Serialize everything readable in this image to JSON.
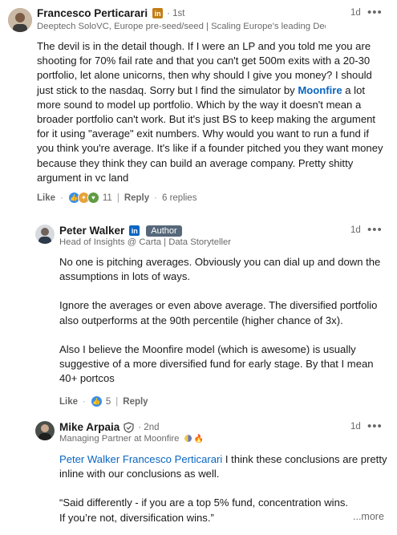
{
  "comments": [
    {
      "author": "Francesco Perticarari",
      "degree": "· 1st",
      "headline": "Deeptech SoloVC, Europe pre-seed/seed | Scaling Europe's leading Dee...",
      "time": "1d",
      "text_a": "The devil is in the detail though. If I were an LP and you told me you are shooting for 70% fail rate and that you can't get 500m exits with a 20-30 portfolio, let alone unicorns, then why should I give you money? I should just stick to the nasdaq. Sorry but I find the simulator by ",
      "text_link": "Moonfire",
      "text_b": " a lot more sound to model up portfolio. Which by the way it doesn't mean a broader portfolio can't work. But it's just BS to keep making the argument for it using \"average\" exit numbers. Why would you want to run a fund if you think you're average. It's like if a founder pitched you they want money because they think they can build an average company. Pretty shitty argument in vc land",
      "like_label": "Like",
      "reaction_count": "11",
      "reply_label": "Reply",
      "replies": "6 replies"
    },
    {
      "author": "Peter Walker",
      "badge": "Author",
      "headline": "Head of Insights @ Carta | Data Storyteller",
      "time": "1d",
      "p1": "No one is pitching averages. Obviously you can dial up and down the assumptions in lots of ways.",
      "p2": "Ignore the averages or even above average. The diversified portfolio also outperforms at the 90th percentile (higher chance of 3x).",
      "p3": "Also I believe the Moonfire model (which is awesome) is usually suggestive of a more diversified fund for early stage. By that I mean 40+ portcos",
      "like_label": "Like",
      "reaction_count": "5",
      "reply_label": "Reply"
    },
    {
      "author": "Mike Arpaia",
      "degree": "· 2nd",
      "headline": "Managing Partner at Moonfire",
      "time": "1d",
      "mention1": "Peter Walker",
      "mention2": "Francesco Perticarari",
      "text_a": " I think these conclusions are pretty inline with our conclusions as well.",
      "quote": "“Said differently - if you are a top 5% fund, concentration wins. If you’re not, diversification wins.”",
      "more_label": "...more"
    }
  ],
  "colors": {
    "link": "#0a66c2",
    "linkedin_badge_1": "#c37d16",
    "linkedin_badge_2": "#0a66c2",
    "author_badge": "#56687a"
  },
  "icons": [
    "linkedin-premium-icon",
    "overflow-menu-icon",
    "like-reaction-icon",
    "celebrate-reaction-icon",
    "support-reaction-icon",
    "verified-shield-icon"
  ]
}
